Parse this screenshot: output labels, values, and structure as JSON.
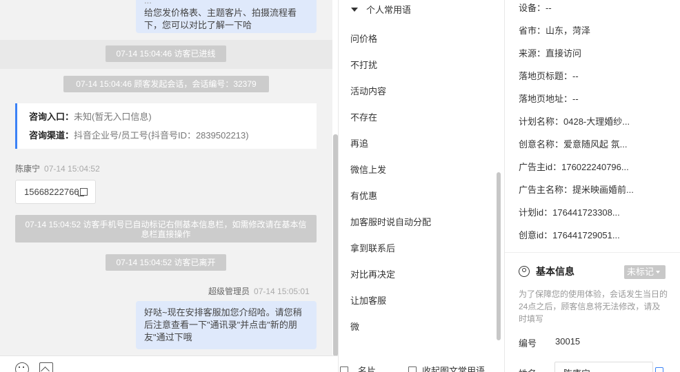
{
  "chat": {
    "top_bubble_lines": [
      "...",
      "给您发价格表、主题客片、拍摄流程看",
      "下，您可以对比了解一下哈"
    ],
    "sys_enter": "07-14 15:04:46 访客已进线",
    "sys_start": "07-14 15:04:46 顾客发起会话，会话编号：32379",
    "card": {
      "entry_label": "咨询入口：",
      "entry_value": "未知(暂无入口信息)",
      "channel_label": "咨询渠道：",
      "channel_value": "抖音企业号/员工号(抖音号ID：2839502213)"
    },
    "visitor_name": "陈康宁",
    "visitor_time": "07-14 15:04:52",
    "phone": "15668222766",
    "sys_phone_note": "07-14 15:04:52 访客手机号已自动标记右侧基本信息栏，如需修改请在基本信息栏直接操作",
    "sys_leave": "07-14 15:04:52 访客已离开",
    "admin_name": "超级管理员",
    "admin_time": "07-14 15:05:01",
    "admin_msg": "好哒~现在安排客服加您介绍哈。请您稍后注意查看一下\"通讯录\"并点击\"新的朋友\"通过下哦"
  },
  "phrases": {
    "header": "个人常用语",
    "items": [
      "问价格",
      "不打扰",
      "活动内容",
      "不存在",
      "再追",
      "微信上发",
      "有优惠",
      "加客服时说自动分配",
      "拿到联系后",
      "对比再决定",
      "让加客服",
      "微"
    ],
    "bottom_left": "名片",
    "bottom_right": "收起图文常用语"
  },
  "info": {
    "rows": [
      "设备：--",
      "省市：山东，菏泽",
      "来源：直接访问",
      "落地页标题：--",
      "落地页地址：--",
      "计划名称：0428-大理婚纱...",
      "创意名称：爱意随风起 氛...",
      "广告主id：176022240796...",
      "广告主名称：提米映画婚前...",
      "计划id：176441723308...",
      "创意id：176441729051..."
    ],
    "section_title": "基本信息",
    "tag_label": "未标记",
    "notice": "为了保障您的使用体验，会话发生当日的24点之后，顾客信息将无法修改，请及时填写",
    "id_label": "编号",
    "id_value": "30015",
    "name_label": "姓名",
    "name_value": "陈康宁"
  }
}
